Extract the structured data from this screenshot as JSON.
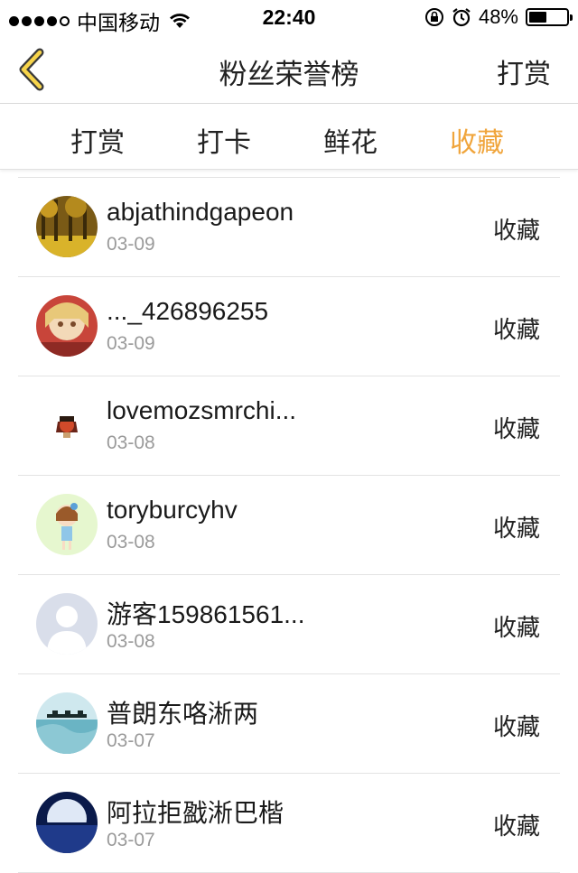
{
  "status": {
    "carrier": "中国移动",
    "time": "22:40",
    "battery": "48%",
    "battery_level": 0.48
  },
  "nav": {
    "title": "粉丝荣誉榜",
    "right": "打赏"
  },
  "tabs": [
    {
      "label": "打赏"
    },
    {
      "label": "打卡"
    },
    {
      "label": "鲜花"
    },
    {
      "label": "收藏",
      "active": true
    }
  ],
  "accent_color": "#f0a53c",
  "list": [
    {
      "name": "abjathindgapeon",
      "date": "03-09",
      "action": "收藏"
    },
    {
      "name": "..._426896255",
      "date": "03-09",
      "action": "收藏"
    },
    {
      "name": "lovemozsmrchi...",
      "date": "03-08",
      "action": "收藏"
    },
    {
      "name": "toryburcyhv",
      "date": "03-08",
      "action": "收藏"
    },
    {
      "name": "游客159861561...",
      "date": "03-08",
      "action": "收藏"
    },
    {
      "name": "普朗东咯淅两",
      "date": "03-07",
      "action": "收藏"
    },
    {
      "name": "阿拉拒戤淅巴楷",
      "date": "03-07",
      "action": "收藏"
    }
  ]
}
